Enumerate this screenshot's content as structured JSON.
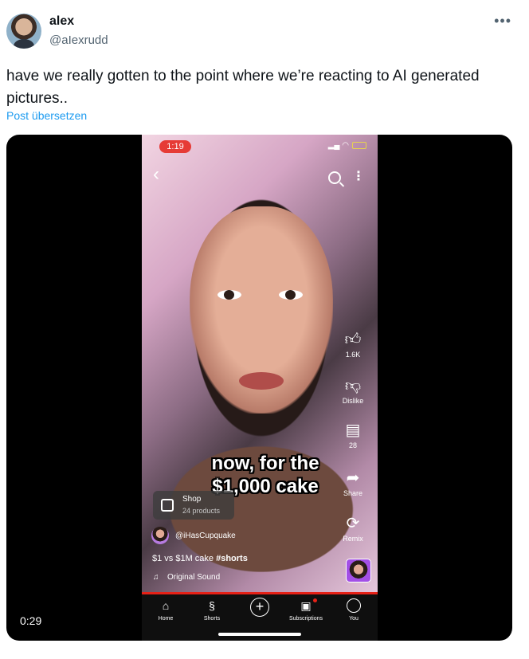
{
  "author": {
    "name": "alex",
    "handle": "@aIexrudd"
  },
  "menu_icon": "more-horizontal-icon",
  "tweet": {
    "text": "have we really gotten to the point where we’re reacting to AI generated pictures..",
    "translate_label": "Post übersetzen"
  },
  "media": {
    "duration": "0:29",
    "phone": {
      "status_time": "1:19",
      "caption_line1": "now, for the",
      "caption_line2": "$1,000 cake",
      "actions": [
        {
          "icon": "thumbs-up-icon",
          "label": "1.6K"
        },
        {
          "icon": "thumbs-down-icon",
          "label": "Dislike"
        },
        {
          "icon": "comment-icon",
          "label": "28"
        },
        {
          "icon": "share-icon",
          "label": "Share"
        },
        {
          "icon": "remix-icon",
          "label": "Remix"
        }
      ],
      "shop": {
        "title": "Shop",
        "subtitle": "24 products"
      },
      "channel": "@iHasCupquake",
      "title_plain": "$1 vs $1M cake ",
      "title_tag": "#shorts",
      "sound": "Original Sound",
      "progress": 1.0,
      "nav": [
        {
          "icon": "home-icon",
          "label": "Home"
        },
        {
          "icon": "shorts-icon",
          "label": "Shorts"
        },
        {
          "icon": "plus-icon",
          "label": ""
        },
        {
          "icon": "subscriptions-icon",
          "label": "Subscriptions"
        },
        {
          "icon": "you-icon",
          "label": "You"
        }
      ]
    }
  },
  "colors": {
    "link_blue": "#1d9bf0",
    "youtube_red": "#e62117"
  }
}
